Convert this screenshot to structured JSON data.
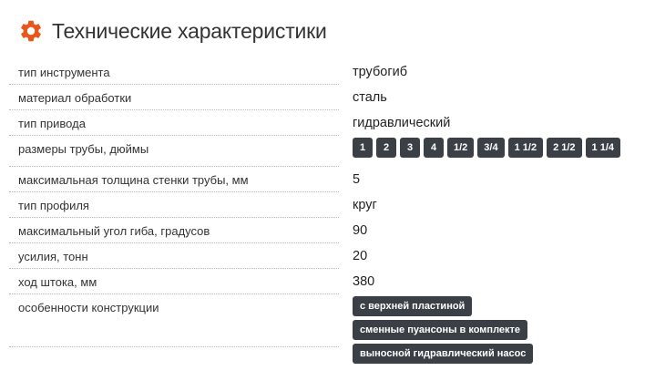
{
  "header": {
    "title": "Технические характеристики",
    "icon": "gear-icon",
    "icon_color": "#e8561c"
  },
  "specs": [
    {
      "label": "тип инструмента",
      "value": "трубогиб"
    },
    {
      "label": "материал обработки",
      "value": "сталь"
    },
    {
      "label": "тип привода",
      "value": "гидравлический"
    },
    {
      "label": "размеры трубы, дюймы",
      "tags": [
        "1",
        "2",
        "3",
        "4",
        "1/2",
        "3/4",
        "1 1/2",
        "2 1/2",
        "1 1/4"
      ]
    },
    {
      "label": "максимальная толщина стенки трубы, мм",
      "value": "5"
    },
    {
      "label": "тип профиля",
      "value": "круг"
    },
    {
      "label": "максимальный угол гиба, градусов",
      "value": "90"
    },
    {
      "label": "усилия, тонн",
      "value": "20"
    },
    {
      "label": "ход штока, мм",
      "value": "380"
    },
    {
      "label": "особенности конструкции",
      "tags": [
        "с верхней пластиной",
        "сменные пуансоны в комплекте",
        "выносной гидравлический насос"
      ]
    }
  ],
  "colors": {
    "tag_bg": "#3b4046",
    "tag_text": "#ffffff",
    "text": "#333333"
  }
}
